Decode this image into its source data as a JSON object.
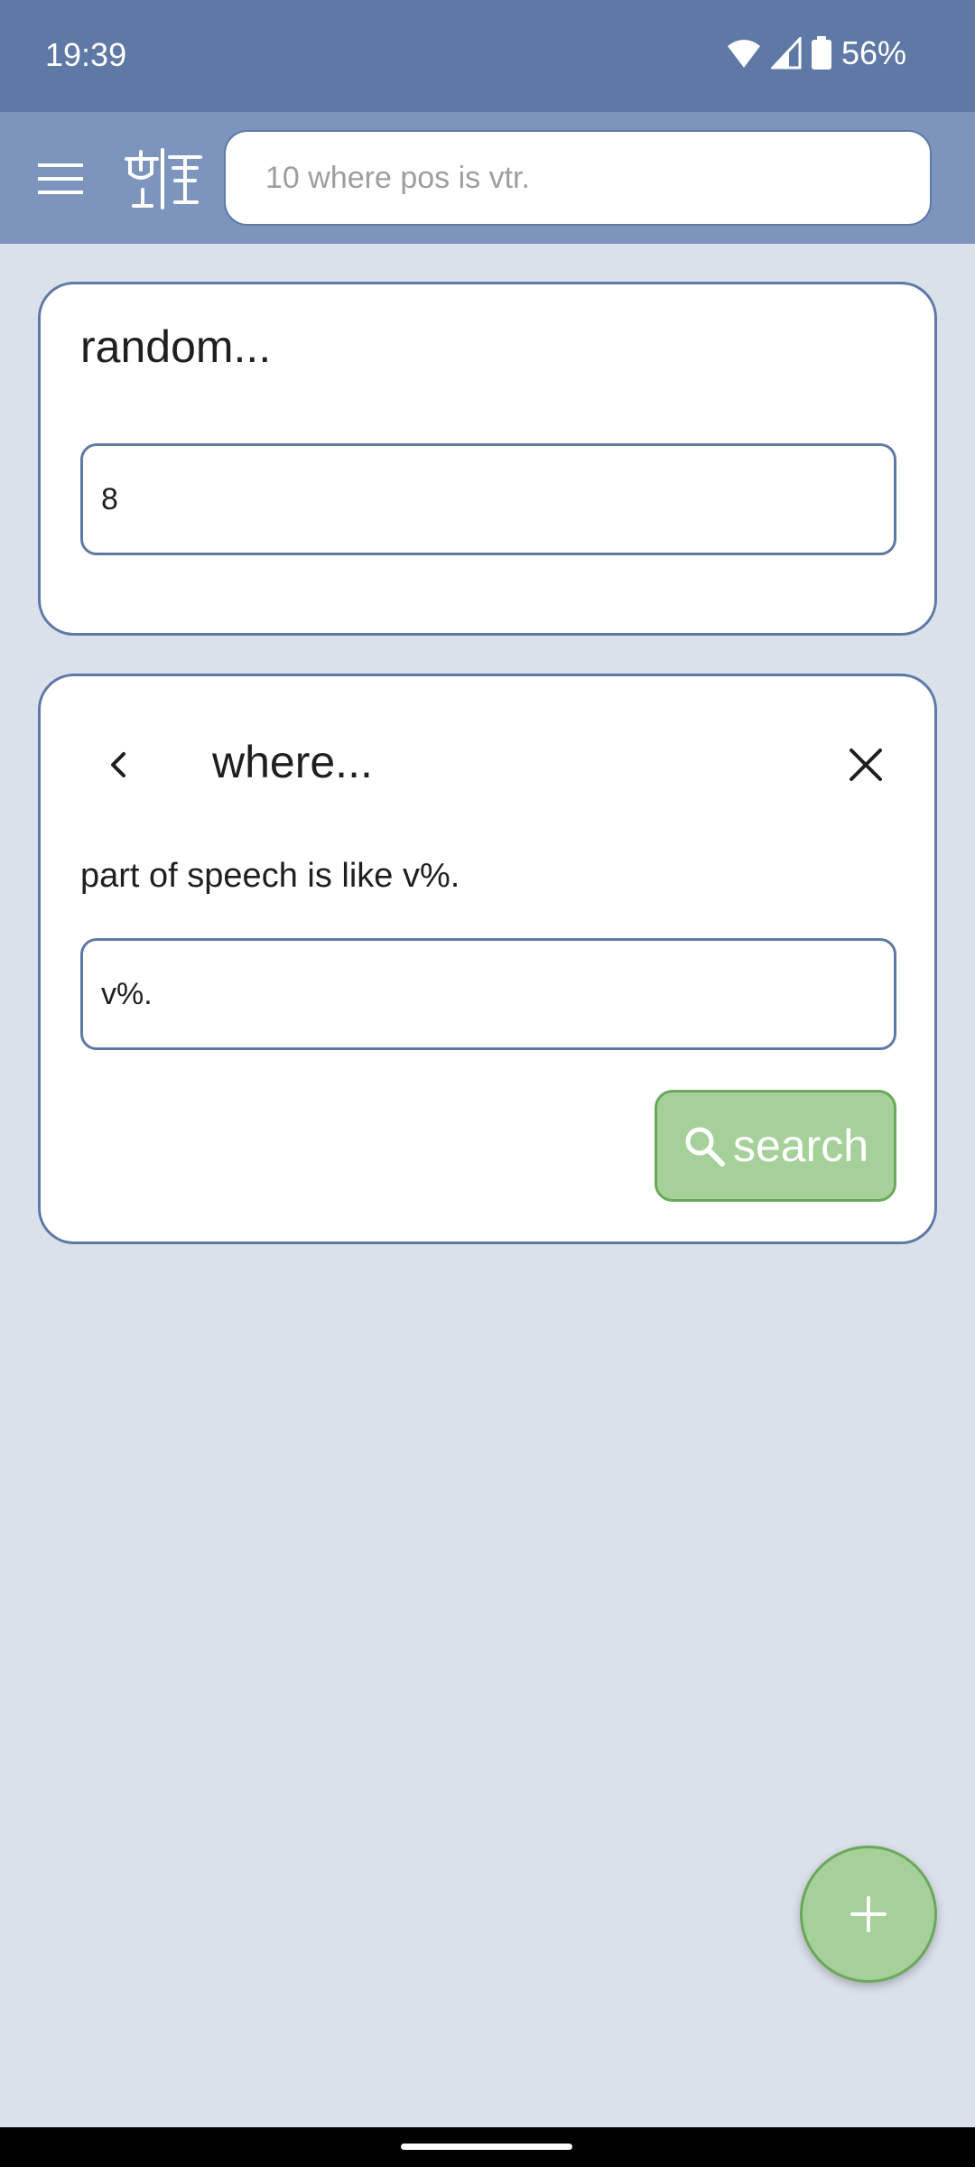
{
  "status": {
    "time": "19:39",
    "battery": "56%"
  },
  "appbar": {
    "search_placeholder": "10 where pos is vtr."
  },
  "cards": [
    {
      "title": "random...",
      "field_value": "8"
    },
    {
      "title": "where...",
      "description": "part of speech is like v%.",
      "field_value": "v%.",
      "search_label": "search"
    }
  ],
  "colors": {
    "statusbar": "#5e79a6",
    "appbar": "#7d95bd",
    "background": "#dbe1eb",
    "accent_green": "#a6d09a"
  },
  "icons": [
    "menu-icon",
    "scale-logo-icon",
    "back-icon",
    "close-icon",
    "magnifier-icon",
    "plus-icon",
    "wifi-icon",
    "signal-icon",
    "battery-icon"
  ]
}
